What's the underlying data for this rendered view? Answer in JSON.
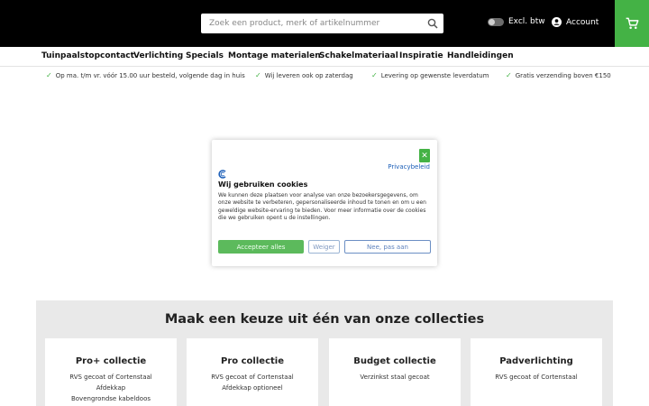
{
  "header": {
    "search_placeholder": "Zoek een product, merk of artikelnummer",
    "btw_label": "Excl. btw",
    "account_label": "Account",
    "accent_color": "#44b245"
  },
  "nav": {
    "items": [
      "Tuinpaalstopcontact",
      "Verlichting",
      "Specials",
      "Montage materialen",
      "Schakelmateriaal",
      "Inspiratie",
      "Handleidingen"
    ]
  },
  "usps": [
    "Op ma. t/m vr. vóór 15.00 uur besteld, volgende dag in huis",
    "Wij leveren ook op zaterdag",
    "Levering op gewenste leverdatum",
    "Gratis verzending boven €150"
  ],
  "cookie_modal": {
    "close_label": "✕",
    "privacy_link": "Privacybeleid",
    "title": "Wij gebruiken cookies",
    "text": "We kunnen deze plaatsen voor analyse van onze bezoekersgegevens, om onze website te verbeteren, gepersonaliseerde inhoud te tonen en om u een geweldige website-ervaring te bieden. Voor meer informatie over de cookies die we gebruiken opent u de instellingen.",
    "accept_label": "Accepteer alles",
    "deny_label": "Weiger",
    "no_label": "Nee, pas aan"
  },
  "collections": {
    "heading": "Maak een keuze uit één van onze collecties",
    "cards": [
      {
        "title": "Pro+ collectie",
        "lines": [
          "RVS gecoat of Cortenstaal",
          "Afdekkap",
          "Bovengrondse kabeldoos"
        ]
      },
      {
        "title": "Pro collectie",
        "lines": [
          "RVS gecoat of Cortenstaal",
          "Afdekkap optioneel"
        ]
      },
      {
        "title": "Budget collectie",
        "lines": [
          "Verzinkst staal gecoat"
        ]
      },
      {
        "title": "Padverlichting",
        "lines": [
          "RVS gecoat of Cortenstaal"
        ]
      }
    ]
  }
}
